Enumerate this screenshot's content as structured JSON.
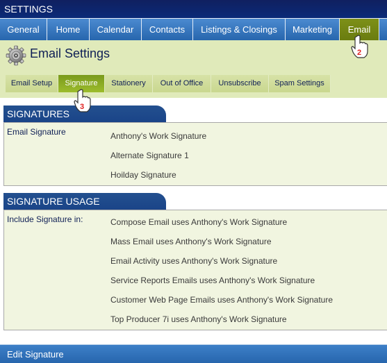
{
  "window": {
    "title": "SETTINGS"
  },
  "top_nav": {
    "tabs": [
      {
        "label": "General",
        "active": false
      },
      {
        "label": "Home",
        "active": false
      },
      {
        "label": "Calendar",
        "active": false
      },
      {
        "label": "Contacts",
        "active": false
      },
      {
        "label": "Listings & Closings",
        "active": false
      },
      {
        "label": "Marketing",
        "active": false
      },
      {
        "label": "Email",
        "active": true
      }
    ]
  },
  "page": {
    "icon": "gear-icon",
    "title": "Email Settings"
  },
  "sub_tabs": [
    {
      "label": "Email Setup",
      "active": false
    },
    {
      "label": "Signature",
      "active": true
    },
    {
      "label": "Stationery",
      "active": false
    },
    {
      "label": "Out of Office",
      "active": false
    },
    {
      "label": "Unsubscribe",
      "active": false
    },
    {
      "label": "Spam Settings",
      "active": false
    }
  ],
  "signatures": {
    "header": "SIGNATURES",
    "label": "Email Signature",
    "items": [
      "Anthony's Work Signature",
      "Alternate Signature 1",
      "Hoilday Signature"
    ]
  },
  "signature_usage": {
    "header": "SIGNATURE USAGE",
    "label": "Include Signature in:",
    "items": [
      "Compose Email uses Anthony's Work Signature",
      "Mass Email uses Anthony's Work Signature",
      "Email Activity uses Anthony's Work Signature",
      "Service Reports Emails uses Anthony's Work Signature",
      "Customer Web Page Emails uses Anthony's Work Signature",
      "Top Producer 7i uses Anthony's Work Signature"
    ]
  },
  "footer": {
    "label": "Edit Signature"
  },
  "annotations": [
    {
      "step": "2",
      "target": "Email"
    },
    {
      "step": "3",
      "target": "Signature"
    }
  ],
  "colors": {
    "title_bar": "#0a2a78",
    "nav_blue": "#2766ad",
    "nav_active_green": "#6a7c10",
    "subheader_bg": "#e0eaba",
    "subtab_active": "#8aab24",
    "section_header": "#1a4488",
    "section_body": "#f1f5e0",
    "step_number_red": "#e02020"
  }
}
